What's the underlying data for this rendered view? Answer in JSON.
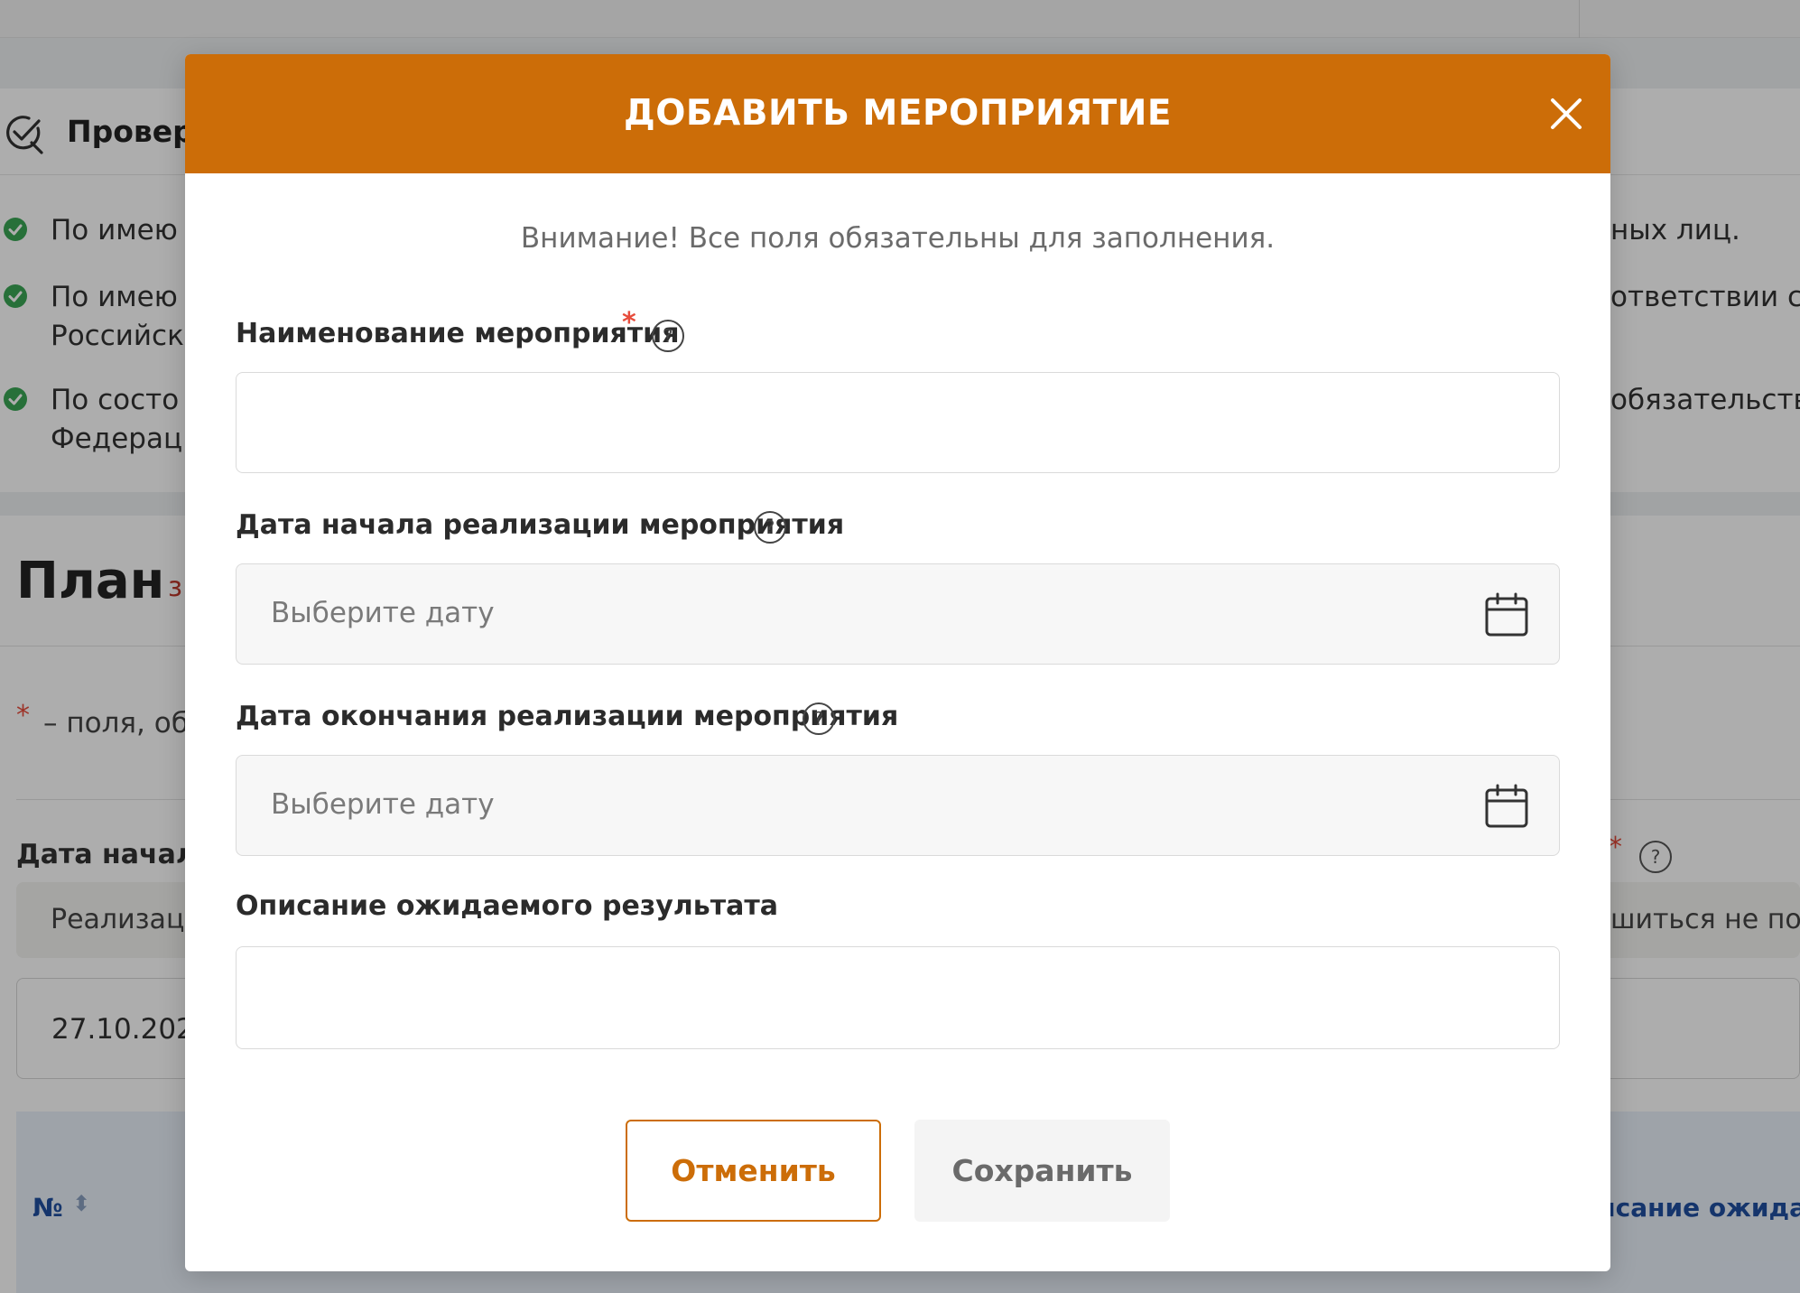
{
  "background": {
    "checks": {
      "title": "Провер",
      "items": [
        {
          "left": "По имею",
          "right": "ных лиц."
        },
        {
          "left": "По имею",
          "left2": "Российск",
          "right": "ответствии с"
        },
        {
          "left": "По состо",
          "left2": "Федерац",
          "right": "обязательств"
        }
      ]
    },
    "plan": {
      "title": "План",
      "subtitle": "з",
      "required_star": "*",
      "required_note": "– поля, об",
      "date_label": "Дата начала",
      "right_star": "*",
      "right_help": "?",
      "hint_left": "Реализаци",
      "hint_right": "шиться не позд",
      "date_value": "27.10.202",
      "table": {
        "col_number": "№",
        "col_sort": "⬍",
        "col_desc": "исание ожидае"
      }
    }
  },
  "modal": {
    "title": "ДОБАВИТЬ МЕРОПРИЯТИЕ",
    "notice": "Внимание! Все поля обязательны для заполнения.",
    "fields": {
      "name": {
        "label": "Наименование мероприятия",
        "required": "*",
        "help": "?",
        "value": ""
      },
      "start_date": {
        "label": "Дата начала реализации мероприятия",
        "help": "?",
        "placeholder": "Выберите дату"
      },
      "end_date": {
        "label": "Дата окончания реализации мероприятия",
        "help": "?",
        "placeholder": "Выберите дату"
      },
      "result": {
        "label": "Описание ожидаемого результата",
        "value": ""
      }
    },
    "buttons": {
      "cancel": "Отменить",
      "save": "Сохранить"
    }
  },
  "colors": {
    "accent": "#cc6d08",
    "required": "#e74c3c",
    "success": "#3aa655",
    "link": "#1f4fa0"
  },
  "icons": {
    "close": "close-icon",
    "calendar": "calendar-icon",
    "check": "check-circle-icon",
    "checklist": "checklist-icon"
  }
}
